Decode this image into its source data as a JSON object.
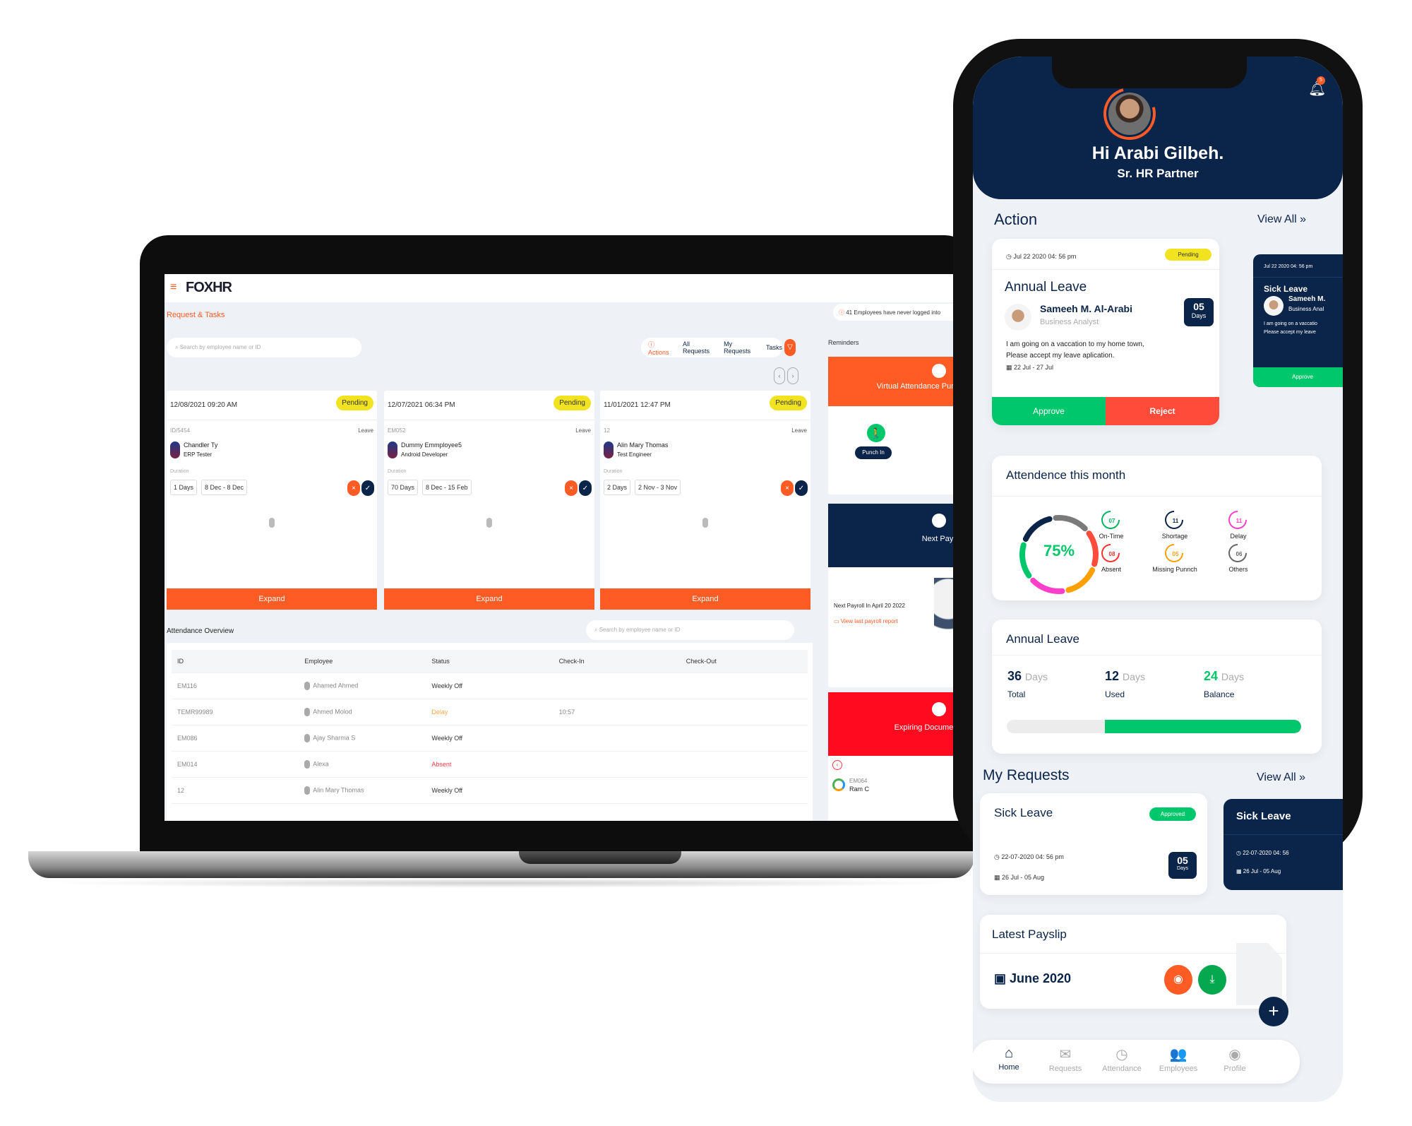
{
  "laptop": {
    "logo": "FOXHR",
    "page_title": "Request & Tasks",
    "search_placeholder": "Search by employee name or ID",
    "tabs": [
      {
        "label": "Actions",
        "badge": "4"
      },
      {
        "label": "All Requests"
      },
      {
        "label": "My Requests"
      },
      {
        "label": "Tasks"
      }
    ],
    "cards": [
      {
        "datetime": "12/08/2021 09:20 AM",
        "status": "Pending",
        "id": "ID/5454",
        "type": "Leave",
        "name": "Chandler Ty",
        "role": "ERP Tester",
        "duration_label": "Duration",
        "days": "1 Days",
        "range": "8 Dec - 8 Dec",
        "expand": "Expand"
      },
      {
        "datetime": "12/07/2021 06:34 PM",
        "status": "Pending",
        "id": "EM052",
        "type": "Leave",
        "name": "Dummy Emmployee5",
        "role": "Android Developer",
        "duration_label": "Duration",
        "days": "70 Days",
        "range": "8 Dec - 15 Feb",
        "expand": "Expand"
      },
      {
        "datetime": "11/01/2021 12:47 PM",
        "status": "Pending",
        "id": "12",
        "type": "Leave",
        "name": "Alin Mary Thomas",
        "role": "Test Engineer",
        "duration_label": "Duration",
        "days": "2 Days",
        "range": "2 Nov - 3 Nov",
        "expand": "Expand"
      }
    ],
    "attendance": {
      "title": "Attendance Overview",
      "search_placeholder": "Search by employee name or ID",
      "columns": [
        "ID",
        "Employee",
        "Status",
        "Check-In",
        "Check-Out"
      ],
      "rows": [
        {
          "id": "EM116",
          "employee": "Ahamed Ahmed",
          "status": "Weekly Off",
          "checkin": "",
          "checkout": ""
        },
        {
          "id": "TEMR99989",
          "employee": "Ahmed Molod",
          "status": "Delay",
          "checkin": "10:57",
          "checkout": ""
        },
        {
          "id": "EM086",
          "employee": "Ajay Sharma S",
          "status": "Weekly Off",
          "checkin": "",
          "checkout": ""
        },
        {
          "id": "EM014",
          "employee": "Alexa",
          "status": "Absent",
          "checkin": "",
          "checkout": ""
        },
        {
          "id": "12",
          "employee": "Alin Mary Thomas",
          "status": "Weekly Off",
          "checkin": "",
          "checkout": ""
        }
      ]
    },
    "alert": "41 Employees have never logged into",
    "reminders": {
      "title": "Reminders",
      "punch": {
        "title": "Virtual Attendance Punch",
        "button": "Punch In"
      },
      "payroll": {
        "title": "Next Payroll",
        "text": "Next Payroll In April 20 2022",
        "link": "View last payroll report"
      },
      "expiring": {
        "title": "Expiring Documents",
        "emp_id": "EM064",
        "emp_name": "Ram C"
      }
    }
  },
  "phone": {
    "notification_count": "5",
    "greeting": "Hi Arabi Gilbeh.",
    "role": "Sr. HR Partner",
    "action": {
      "title": "Action",
      "view_all": "View All",
      "card": {
        "datetime": "Jul  22  2020  04: 56 pm",
        "status": "Pending",
        "type": "Annual Leave",
        "name": "Sameeh M. Al-Arabi",
        "role": "Business Analyst",
        "days": "05",
        "days_unit": "Days",
        "message1": "I am going on a vaccation to my home town,",
        "message2": "Please accept my  leave aplication.",
        "range": "22 Jul  -  27 Jul",
        "approve": "Approve",
        "reject": "Reject"
      },
      "card2": {
        "datetime": "Jul  22  2020  04: 56 pm",
        "type": "Sick Leave",
        "name": "Sameeh M.",
        "role": "Business Anal",
        "message1": "I am going on a vaccatio",
        "message2": "Please accept my  leave",
        "approve": "Approve"
      }
    },
    "attendance": {
      "title": "Attendence this month",
      "percent": "75%",
      "segments": [
        "#7a7a7a",
        "#ff4b3a",
        "#ffa000",
        "#ff3ec9",
        "#00c76b",
        "#0b2449"
      ],
      "stats": [
        {
          "label": "On-Time",
          "value": "07",
          "color": "#00b35c"
        },
        {
          "label": "Shortage",
          "value": "11",
          "color": "#0b2449"
        },
        {
          "label": "Delay",
          "value": "11",
          "color": "#ff3ec9"
        },
        {
          "label": "Absent",
          "value": "08",
          "color": "#ff3030"
        },
        {
          "label": "Missing Punnch",
          "value": "05",
          "color": "#ffa000"
        },
        {
          "label": "Others",
          "value": "06",
          "color": "#666666"
        }
      ]
    },
    "annual_leave": {
      "title": "Annual Leave",
      "unit": "Days",
      "total": "36",
      "total_label": "Total",
      "used": "12",
      "used_label": "Used",
      "balance": "24",
      "balance_label": "Balance",
      "balance_fraction": 0.667
    },
    "my_requests": {
      "title": "My Requests",
      "view_all": "View All",
      "card": {
        "type": "Sick Leave",
        "status": "Approved",
        "datetime": "22-07-2020 04: 56 pm",
        "range": "26 Jul  -  05 Aug",
        "days": "05",
        "days_unit": "Days"
      },
      "card2": {
        "type": "Sick Leave",
        "datetime": "22-07-2020 04: 56",
        "range": "26 Jul  -  05 Aug"
      }
    },
    "payslip": {
      "title": "Latest Payslip",
      "month": "June 2020"
    },
    "nav": [
      {
        "label": "Home",
        "icon": "home-icon",
        "glyph": "⌂"
      },
      {
        "label": "Requests",
        "icon": "envelope-open-icon",
        "glyph": "✉"
      },
      {
        "label": "Attendance",
        "icon": "clock-icon",
        "glyph": "◷"
      },
      {
        "label": "Employees",
        "icon": "people-icon",
        "glyph": "👥"
      },
      {
        "label": "Profile",
        "icon": "user-circle-icon",
        "glyph": "◉"
      }
    ],
    "colors": {
      "navy": "#0b2449",
      "orange": "#ff5b24",
      "green": "#00c76b",
      "red": "#ff4b3a",
      "yellow": "#f2e321"
    }
  }
}
